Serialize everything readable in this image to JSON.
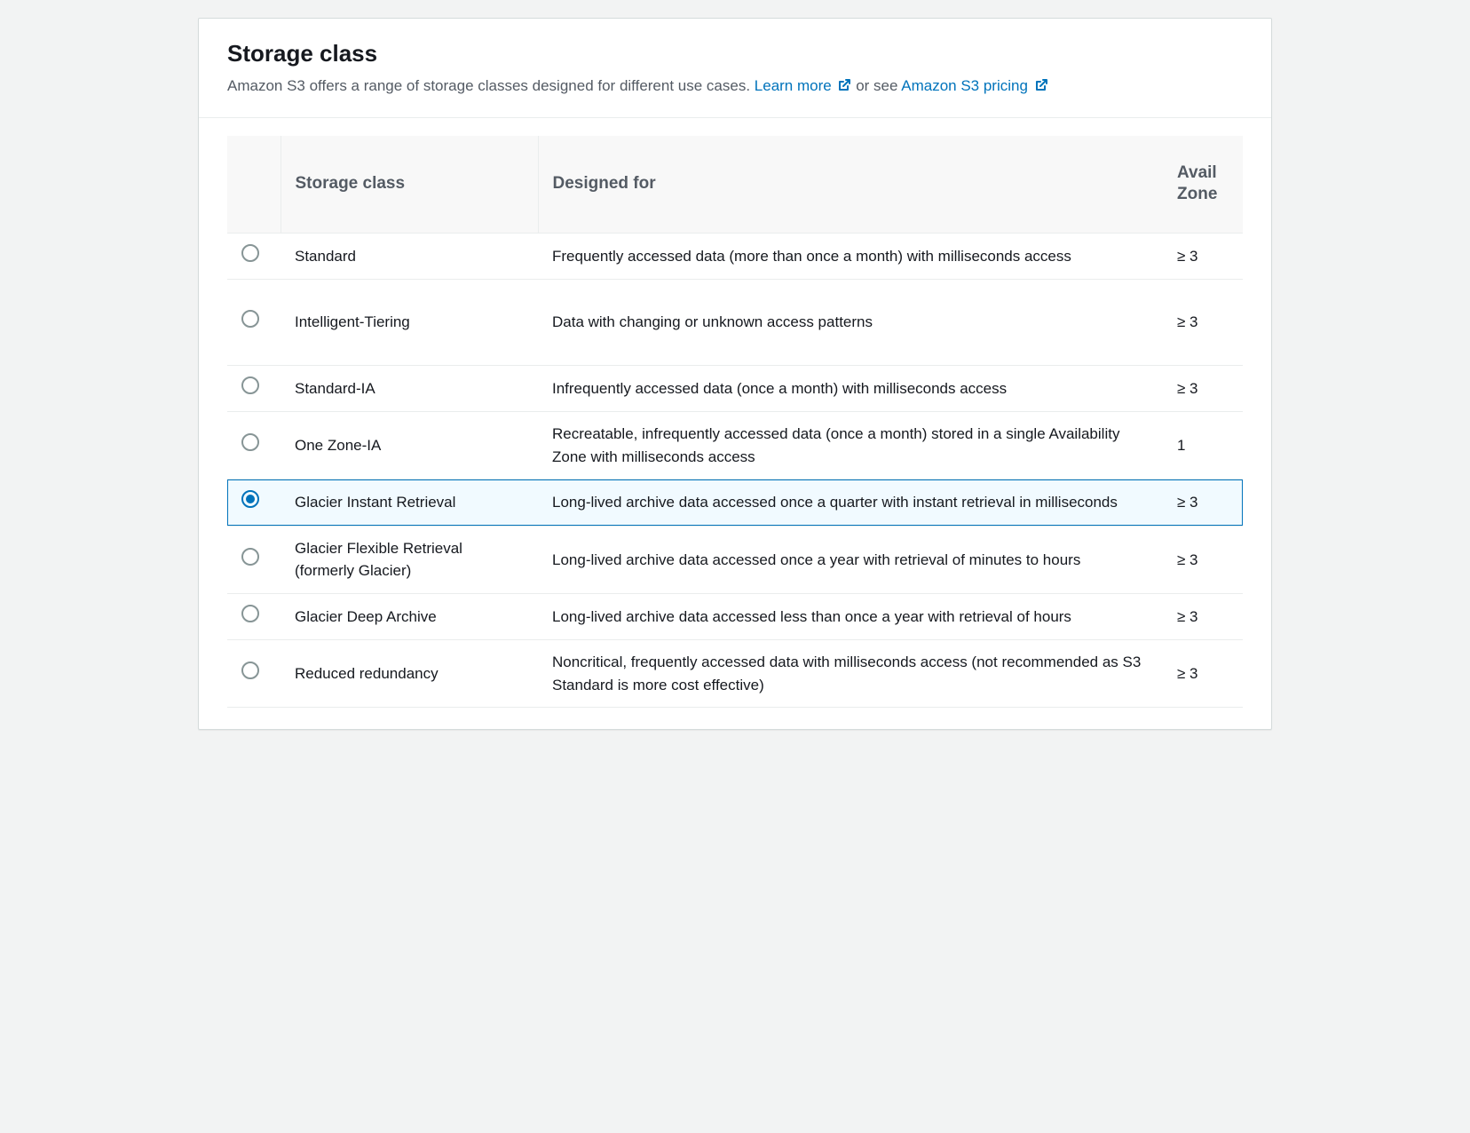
{
  "header": {
    "title": "Storage class",
    "desc_before": "Amazon S3 offers a range of storage classes designed for different use cases. ",
    "learn_more": "Learn more",
    "desc_middle": " or see ",
    "pricing": "Amazon S3 pricing"
  },
  "table": {
    "columns": {
      "name": "Storage class",
      "desc": "Designed for",
      "zone_line1": "Avail",
      "zone_line2": "Zone"
    },
    "rows": [
      {
        "name": "Standard",
        "desc": "Frequently accessed data (more than once a month) with milliseconds access",
        "zone": "≥ 3",
        "selected": false,
        "tall": false
      },
      {
        "name": "Intelligent-Tiering",
        "desc": "Data with changing or unknown access patterns",
        "zone": "≥ 3",
        "selected": false,
        "tall": true
      },
      {
        "name": "Standard-IA",
        "desc": "Infrequently accessed data (once a month) with milliseconds access",
        "zone": "≥ 3",
        "selected": false,
        "tall": false
      },
      {
        "name": "One Zone-IA",
        "desc": "Recreatable, infrequently accessed data (once a month) stored in a single Availability Zone with milliseconds access",
        "zone": "1",
        "selected": false,
        "tall": false
      },
      {
        "name": "Glacier Instant Retrieval",
        "desc": "Long-lived archive data accessed once a quarter with instant retrieval in milliseconds",
        "zone": "≥ 3",
        "selected": true,
        "tall": false
      },
      {
        "name": "Glacier Flexible Retrieval (formerly Glacier)",
        "desc": "Long-lived archive data accessed once a year with retrieval of minutes to hours",
        "zone": "≥ 3",
        "selected": false,
        "tall": false
      },
      {
        "name": "Glacier Deep Archive",
        "desc": "Long-lived archive data accessed less than once a year with retrieval of hours",
        "zone": "≥ 3",
        "selected": false,
        "tall": false
      },
      {
        "name": "Reduced redundancy",
        "desc": "Noncritical, frequently accessed data with milliseconds access (not recommended as S3 Standard is more cost effective)",
        "zone": "≥ 3",
        "selected": false,
        "tall": false
      }
    ]
  }
}
